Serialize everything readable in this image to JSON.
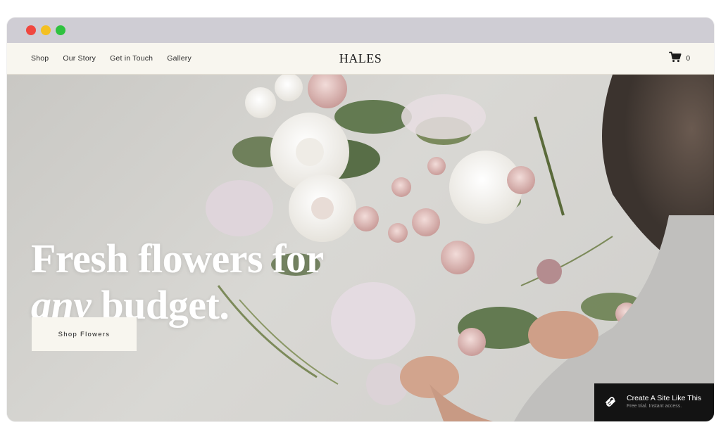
{
  "nav": {
    "items": [
      {
        "label": "Shop"
      },
      {
        "label": "Our Story"
      },
      {
        "label": "Get in Touch"
      },
      {
        "label": "Gallery"
      }
    ]
  },
  "brand": {
    "logo": "HALES"
  },
  "cart": {
    "icon": "cart-icon",
    "count": "0"
  },
  "hero": {
    "headline_line1": "Fresh flowers for",
    "headline_line2_italic": "any",
    "headline_line2_rest": " budget.",
    "cta_label": "Shop Flowers"
  },
  "promo": {
    "icon": "squarespace-logo-icon",
    "title": "Create A Site Like This",
    "subtitle": "Free trial. Instant access."
  },
  "colors": {
    "header_bg": "#f8f6ef",
    "chrome_bg": "#cfcdd4",
    "promo_bg": "#131313"
  }
}
